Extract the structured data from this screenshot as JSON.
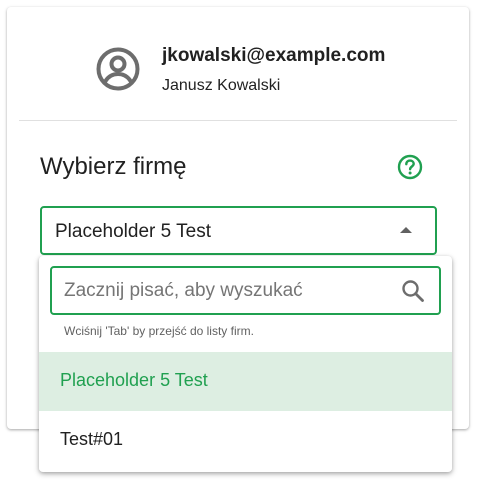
{
  "user": {
    "email": "jkowalski@example.com",
    "name": "Janusz Kowalski",
    "avatar_icon": "account-circle-icon"
  },
  "company_picker": {
    "title": "Wybierz firmę",
    "help_icon": "help-circle-icon",
    "selected_value": "Placeholder 5 Test",
    "caret_icon": "caret-up-icon"
  },
  "dropdown": {
    "search": {
      "placeholder": "Zacznij pisać, aby wyszukać",
      "value": "",
      "icon": "search-icon"
    },
    "hint": "Wciśnij 'Tab' by przejść do listy firm.",
    "options": [
      {
        "label": "Placeholder 5 Test",
        "selected": true
      },
      {
        "label": "Test#01",
        "selected": false
      }
    ]
  },
  "colors": {
    "accent": "#20a050",
    "selected_bg": "#ddeee2",
    "icon_gray": "#6d6d6d"
  }
}
